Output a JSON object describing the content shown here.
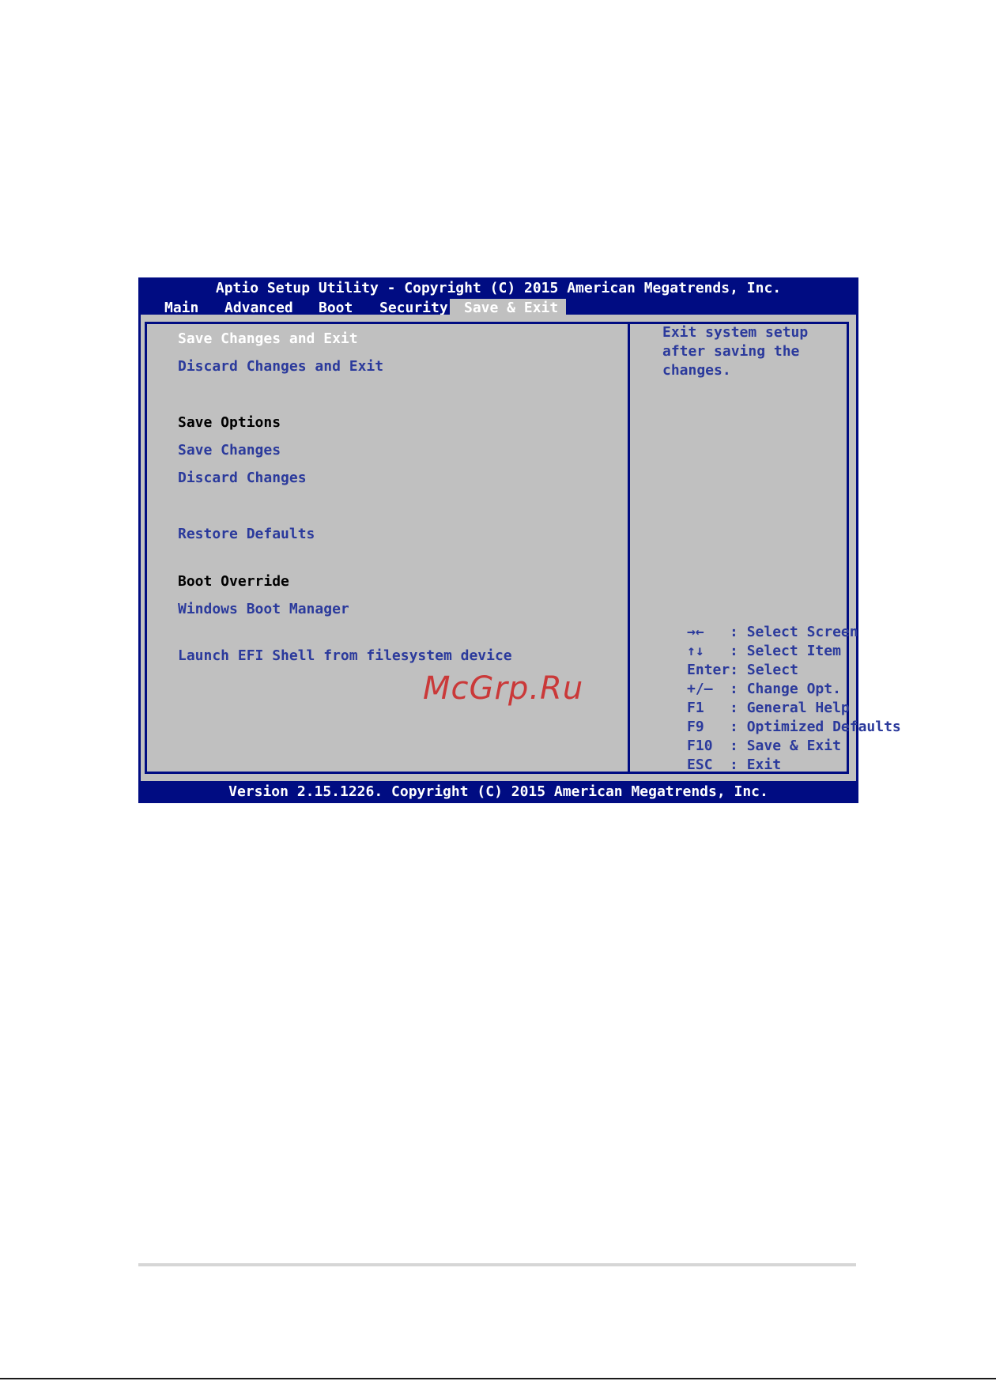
{
  "bios": {
    "title": "Aptio Setup Utility - Copyright (C) 2015 American Megatrends, Inc.",
    "tabs": [
      {
        "label": "Main"
      },
      {
        "label": "Advanced"
      },
      {
        "label": "Boot"
      },
      {
        "label": "Security"
      },
      {
        "label": "Save & Exit"
      }
    ],
    "active_tab": "Save & Exit",
    "menu": {
      "save_changes_and_exit": "Save Changes and Exit",
      "discard_changes_and_exit": "Discard Changes and Exit",
      "save_options_heading": "Save Options",
      "save_changes": "Save Changes",
      "discard_changes": "Discard Changes",
      "restore_defaults": "Restore Defaults",
      "boot_override_heading": "Boot Override",
      "windows_boot_manager": "Windows Boot Manager",
      "launch_efi_shell": "Launch EFI Shell from filesystem device"
    },
    "help": [
      "Exit system setup",
      "after saving the",
      "changes."
    ],
    "keys": [
      {
        "key": "→←",
        "desc": ": Select Screen"
      },
      {
        "key": "↑↓",
        "desc": ": Select Item"
      },
      {
        "key": "Enter",
        "desc": ": Select"
      },
      {
        "key": "+/—",
        "desc": ": Change Opt."
      },
      {
        "key": "F1",
        "desc": ": General Help"
      },
      {
        "key": "F9",
        "desc": ": Optimized Defaults"
      },
      {
        "key": "F10",
        "desc": ": Save & Exit"
      },
      {
        "key": "ESC",
        "desc": ": Exit"
      }
    ],
    "footer": "Version 2.15.1226. Copyright (C) 2015 American Megatrends, Inc."
  },
  "watermark": "McGrp.Ru",
  "colors": {
    "bios_blue": "#000c82",
    "bios_gray": "#c0c0c0",
    "item_text": "#2b3a9c",
    "watermark_red": "#cc2b2b"
  }
}
